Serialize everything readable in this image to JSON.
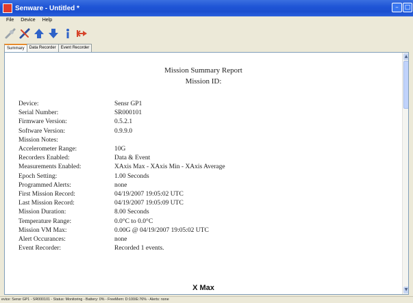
{
  "window": {
    "title": "Senware - Untitled *"
  },
  "menu": {
    "items": [
      "File",
      "Device",
      "Help"
    ]
  },
  "toolbar": {
    "tools": [
      {
        "icon": "connect-icon",
        "color": "#9aa3aa"
      },
      {
        "icon": "disconnect-icon",
        "color": "#2f4fa0"
      },
      {
        "icon": "upload-arrow-icon",
        "color": "#2f63c8"
      },
      {
        "icon": "download-arrow-icon",
        "color": "#2f63c8"
      },
      {
        "icon": "info-icon",
        "color": "#2f63c8"
      },
      {
        "icon": "range-arrows-icon",
        "color": "#d6452b"
      }
    ]
  },
  "tabs": [
    {
      "label": "Summary",
      "active": true
    },
    {
      "label": "Data Recorder",
      "active": false
    },
    {
      "label": "Event Recorder",
      "active": false
    }
  ],
  "report": {
    "title": "Mission Summary Report",
    "mission_id_label": "Mission ID:",
    "rows": [
      {
        "label": "Device:",
        "value": "Sensr GP1"
      },
      {
        "label": "Serial Number:",
        "value": "SR000101"
      },
      {
        "label": "Firmware Version:",
        "value": "0.5.2.1"
      },
      {
        "label": "Software Version:",
        "value": "0.9.9.0"
      },
      {
        "label": "Mission Notes:",
        "value": ""
      },
      {
        "label": "Accelerometer Range:",
        "value": "10G"
      },
      {
        "label": "Recorders Enabled:",
        "value": "Data & Event"
      },
      {
        "label": "Measurements Enabled:",
        "value": "XAxis Max - XAxis Min - XAxis Average"
      },
      {
        "label": "Epoch Setting:",
        "value": "1.00 Seconds"
      },
      {
        "label": "Programmed Alerts:",
        "value": "none"
      },
      {
        "label": "First Mission Record:",
        "value": "04/19/2007 19:05:02 UTC"
      },
      {
        "label": "Last Mission Record:",
        "value": "04/19/2007 19:05:09 UTC"
      },
      {
        "label": "Mission Duration:",
        "value": "8.00 Seconds"
      },
      {
        "label": "Temperature Range:",
        "value": "0.0°C to 0.0°C"
      },
      {
        "label": "Mission VM Max:",
        "value": "0.00G @ 04/19/2007 19:05:02 UTC"
      },
      {
        "label": "Alert Occurances:",
        "value": "none"
      },
      {
        "label": "Event Recorder:",
        "value": "Recorded 1 events."
      }
    ],
    "section_heading": "X Max"
  },
  "status": {
    "text": "evice: Sensr GP1 - SR000101 - Status: Monitoring - Battery: 0% - FreeMem: D:100/E:76% - Alerts: none"
  }
}
